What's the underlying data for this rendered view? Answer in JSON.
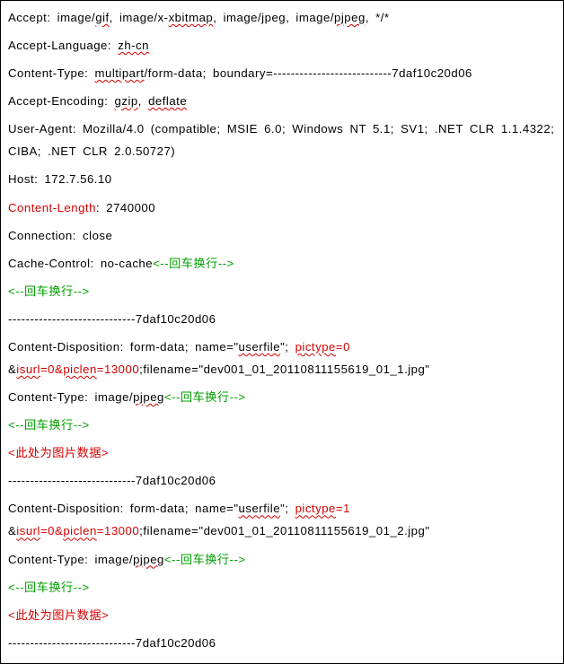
{
  "lines": [
    {
      "segs": [
        {
          "t": "Accept: image/"
        },
        {
          "t": "gif",
          "u": true
        },
        {
          "t": ", image/x-"
        },
        {
          "t": "xbitmap",
          "u": true
        },
        {
          "t": ", image/jpeg, image/"
        },
        {
          "t": "pjpeg",
          "u": true
        },
        {
          "t": ", */*"
        }
      ]
    },
    {
      "segs": [
        {
          "t": "Accept-Language: "
        },
        {
          "t": "zh-cn",
          "u": true
        }
      ]
    },
    {
      "segs": [
        {
          "t": "Content-Type: "
        },
        {
          "t": "multipart",
          "u": true
        },
        {
          "t": "/form-data; boundary=---------------------------7daf10c20d06"
        }
      ]
    },
    {
      "segs": [
        {
          "t": "Accept-Encoding: "
        },
        {
          "t": "gzip",
          "u": true
        },
        {
          "t": ", "
        },
        {
          "t": "deflate",
          "u": true
        }
      ]
    },
    {
      "segs": [
        {
          "t": "User-Agent: Mozilla/4.0 (compatible; MSIE 6.0; Windows NT 5.1; SV1; .NET CLR 1.1.4322; CIBA; .NET CLR 2.0.50727)"
        }
      ]
    },
    {
      "segs": [
        {
          "t": "Host: 172.7.56.10"
        }
      ]
    },
    {
      "segs": [
        {
          "t": "Content-Length",
          "c": "red"
        },
        {
          "t": ": 2740000"
        }
      ]
    },
    {
      "segs": [
        {
          "t": "Connection: close"
        }
      ]
    },
    {
      "segs": [
        {
          "t": "Cache-Control: no-cache"
        },
        {
          "t": "<--回车换行-->",
          "c": "green"
        }
      ]
    },
    {
      "segs": [
        {
          "t": "<--回车换行-->",
          "c": "green"
        }
      ]
    },
    {
      "segs": [
        {
          "t": "-----------------------------7daf10c20d06"
        }
      ]
    },
    {
      "segs": [
        {
          "t": "Content-Disposition: form-data; name=\""
        },
        {
          "t": "userfile",
          "u": true
        },
        {
          "t": "\"; "
        },
        {
          "t": "pictype",
          "u": true,
          "c": "red"
        },
        {
          "t": "=0",
          "c": "red"
        },
        {
          "t": " &"
        },
        {
          "t": "isurl",
          "u": true,
          "c": "red"
        },
        {
          "t": "=0&",
          "c": "red"
        },
        {
          "t": "piclen",
          "u": true,
          "c": "red"
        },
        {
          "t": "=13000",
          "c": "red"
        },
        {
          "t": ";filename=\"dev001_01_20110811155619_01_1.jpg\""
        }
      ]
    },
    {
      "segs": [
        {
          "t": "Content-Type: image/"
        },
        {
          "t": "pjpeg",
          "u": true
        },
        {
          "t": "<--回车换行-->",
          "c": "green"
        }
      ]
    },
    {
      "segs": [
        {
          "t": "<--回车换行-->",
          "c": "green"
        }
      ]
    },
    {
      "segs": [
        {
          "t": "<此处为图片数据>",
          "c": "red"
        }
      ]
    },
    {
      "segs": [
        {
          "t": "-----------------------------7daf10c20d06"
        }
      ]
    },
    {
      "segs": [
        {
          "t": "Content-Disposition: form-data; name=\""
        },
        {
          "t": "userfile",
          "u": true
        },
        {
          "t": "\"; "
        },
        {
          "t": "pictype",
          "u": true,
          "c": "red"
        },
        {
          "t": "=1",
          "c": "red"
        },
        {
          "t": " &"
        },
        {
          "t": "isurl",
          "u": true,
          "c": "red"
        },
        {
          "t": "=0&",
          "c": "red"
        },
        {
          "t": "piclen",
          "u": true,
          "c": "red"
        },
        {
          "t": "=13000",
          "c": "red"
        },
        {
          "t": ";filename=\"dev001_01_20110811155619_01_2.jpg\""
        }
      ]
    },
    {
      "segs": [
        {
          "t": "Content-Type: image/"
        },
        {
          "t": "pjpeg",
          "u": true
        },
        {
          "t": "<--回车换行-->",
          "c": "green"
        }
      ]
    },
    {
      "segs": [
        {
          "t": "<--回车换行-->",
          "c": "green"
        }
      ]
    },
    {
      "segs": [
        {
          "t": "<此处为图片数据>",
          "c": "red"
        }
      ]
    },
    {
      "segs": [
        {
          "t": "-----------------------------7daf10c20d06"
        }
      ]
    }
  ]
}
